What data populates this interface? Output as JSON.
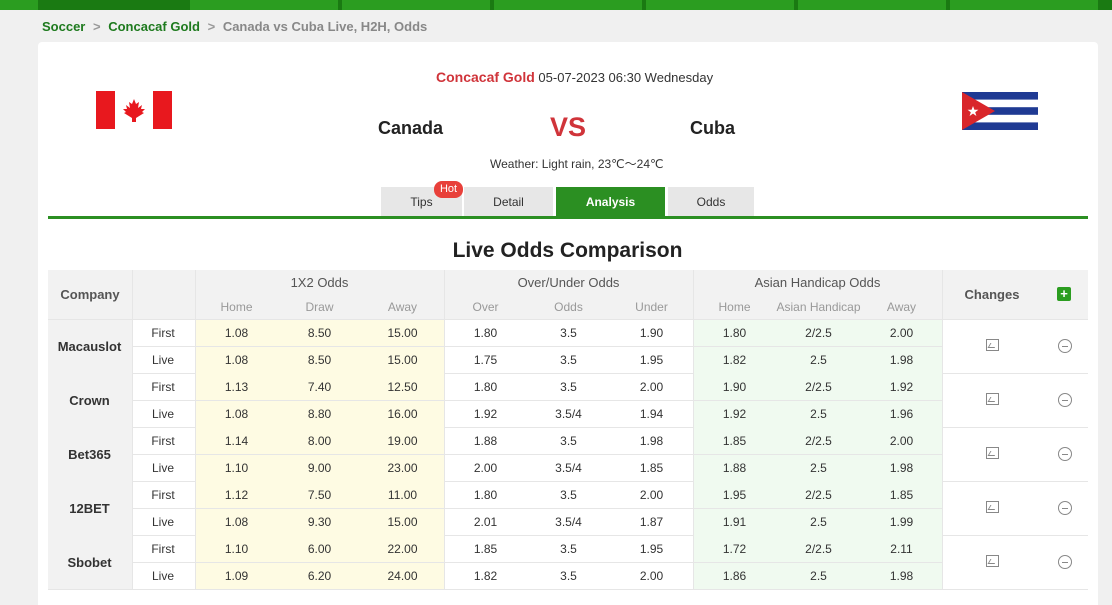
{
  "breadcrumb": {
    "items": [
      "Soccer",
      "Concacaf Gold"
    ],
    "separator": ">",
    "current": "Canada vs Cuba Live, H2H, Odds"
  },
  "match": {
    "league": "Concacaf Gold",
    "datetime": "05-07-2023 06:30 Wednesday",
    "home_team": "Canada",
    "away_team": "Cuba",
    "vs_label": "VS",
    "weather": "Weather: Light rain, 23℃～24℃"
  },
  "tabs": [
    {
      "label": "Tips",
      "badge": "Hot",
      "active": false
    },
    {
      "label": "Detail",
      "active": false
    },
    {
      "label": "Analysis",
      "active": true
    },
    {
      "label": "Odds",
      "active": false
    }
  ],
  "section_title": "Live Odds Comparison",
  "table": {
    "company_header": "Company",
    "changes_header": "Changes",
    "plus_label": "+",
    "groups": {
      "x12": {
        "title": "1X2 Odds",
        "cols": [
          "Home",
          "Draw",
          "Away"
        ]
      },
      "ou": {
        "title": "Over/Under Odds",
        "cols": [
          "Over",
          "Odds",
          "Under"
        ]
      },
      "ah": {
        "title": "Asian Handicap Odds",
        "cols": [
          "Home",
          "Asian Handicap",
          "Away"
        ]
      }
    },
    "rows": [
      {
        "company": "Macauslot",
        "first": {
          "type": "First",
          "x12": [
            "1.08",
            "8.50",
            "15.00"
          ],
          "ou": [
            "1.80",
            "3.5",
            "1.90"
          ],
          "ah": [
            "1.80",
            "2/2.5",
            "2.00"
          ]
        },
        "live": {
          "type": "Live",
          "x12": [
            "1.08",
            "8.50",
            "15.00"
          ],
          "ou": [
            "1.75",
            "3.5",
            "1.95"
          ],
          "ah": [
            "1.82",
            "2.5",
            "1.98"
          ]
        }
      },
      {
        "company": "Crown",
        "first": {
          "type": "First",
          "x12": [
            "1.13",
            "7.40",
            "12.50"
          ],
          "ou": [
            "1.80",
            "3.5",
            "2.00"
          ],
          "ah": [
            "1.90",
            "2/2.5",
            "1.92"
          ]
        },
        "live": {
          "type": "Live",
          "x12": [
            "1.08",
            "8.80",
            "16.00"
          ],
          "ou": [
            "1.92",
            "3.5/4",
            "1.94"
          ],
          "ah": [
            "1.92",
            "2.5",
            "1.96"
          ]
        }
      },
      {
        "company": "Bet365",
        "first": {
          "type": "First",
          "x12": [
            "1.14",
            "8.00",
            "19.00"
          ],
          "ou": [
            "1.88",
            "3.5",
            "1.98"
          ],
          "ah": [
            "1.85",
            "2/2.5",
            "2.00"
          ]
        },
        "live": {
          "type": "Live",
          "x12": [
            "1.10",
            "9.00",
            "23.00"
          ],
          "ou": [
            "2.00",
            "3.5/4",
            "1.85"
          ],
          "ah": [
            "1.88",
            "2.5",
            "1.98"
          ]
        }
      },
      {
        "company": "12BET",
        "first": {
          "type": "First",
          "x12": [
            "1.12",
            "7.50",
            "11.00"
          ],
          "ou": [
            "1.80",
            "3.5",
            "2.00"
          ],
          "ah": [
            "1.95",
            "2/2.5",
            "1.85"
          ]
        },
        "live": {
          "type": "Live",
          "x12": [
            "1.08",
            "9.30",
            "15.00"
          ],
          "ou": [
            "2.01",
            "3.5/4",
            "1.87"
          ],
          "ah": [
            "1.91",
            "2.5",
            "1.99"
          ]
        }
      },
      {
        "company": "Sbobet",
        "first": {
          "type": "First",
          "x12": [
            "1.10",
            "6.00",
            "22.00"
          ],
          "ou": [
            "1.85",
            "3.5",
            "1.95"
          ],
          "ah": [
            "1.72",
            "2/2.5",
            "2.11"
          ]
        },
        "live": {
          "type": "Live",
          "x12": [
            "1.09",
            "6.20",
            "24.00"
          ],
          "ou": [
            "1.82",
            "3.5",
            "2.00"
          ],
          "ah": [
            "1.86",
            "2.5",
            "1.98"
          ]
        }
      }
    ]
  },
  "colors": {
    "brand_green": "#2b8f22",
    "accent_red": "#d0343a",
    "x12_bg": "#fefbe3",
    "ah_bg": "#f0faf0"
  }
}
